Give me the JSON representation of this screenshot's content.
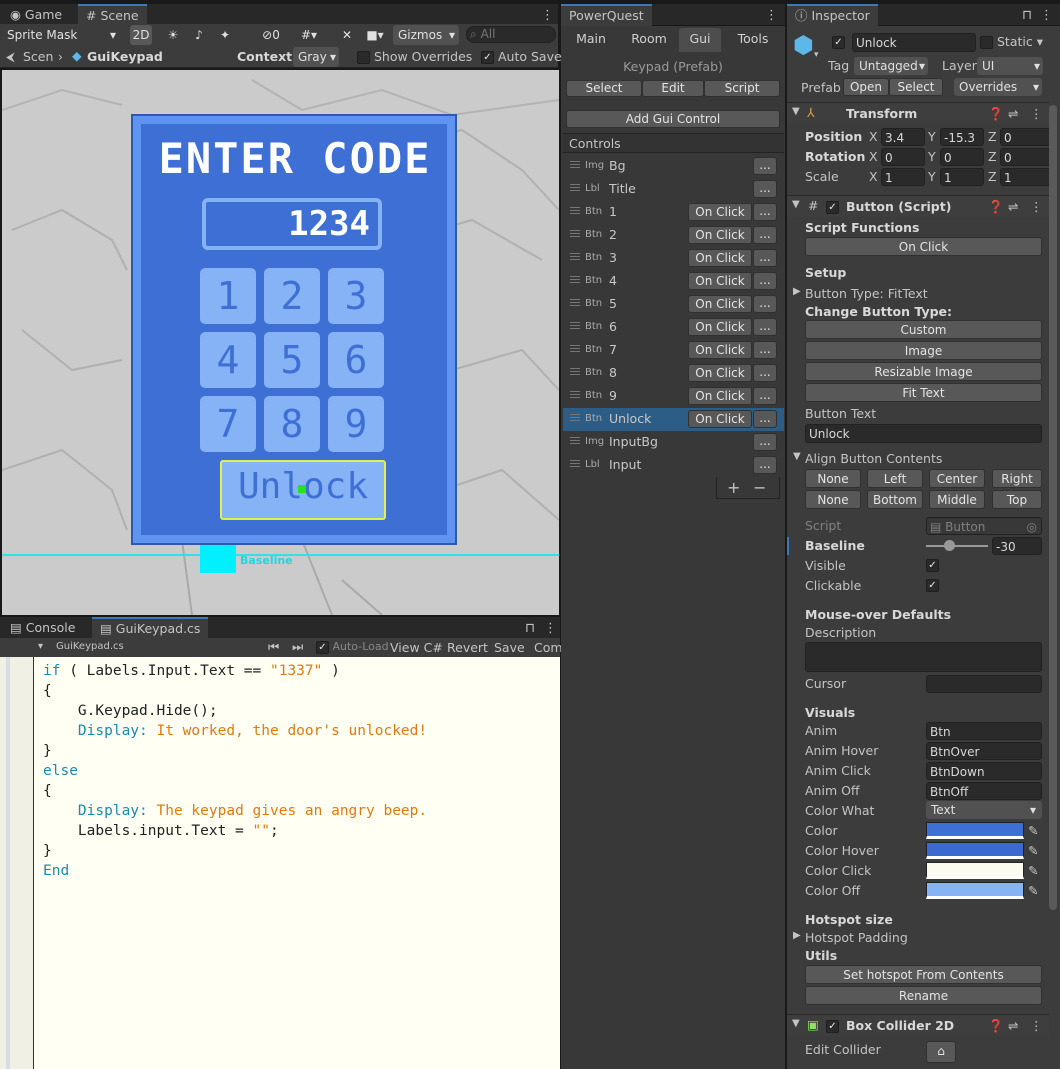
{
  "scene": {
    "tab_game": "Game",
    "tab_scene": "Scene",
    "sprite_mask": "Sprite Mask",
    "btn_2d": "2D",
    "hidden_count": "0",
    "gizmos": "Gizmos",
    "search_placeholder": "All",
    "breadcrumb_root": "Scen",
    "breadcrumb_prefab": "GuiKeypad",
    "context_label": "Context:",
    "context_value": "Gray",
    "show_overrides": "Show Overrides",
    "auto_save": "Auto Save",
    "baseline_label": "Baseline",
    "keypad": {
      "title": "ENTER CODE",
      "input": "1234",
      "keys": [
        "1",
        "2",
        "3",
        "4",
        "5",
        "6",
        "7",
        "8",
        "9"
      ],
      "unlock": "Unlock"
    }
  },
  "editor": {
    "tab_console": "Console",
    "tab_file": "GuiKeypad.cs",
    "file_label": "GuiKeypad.cs",
    "auto_load": "Auto-Load",
    "view_cs": "View C#",
    "revert": "Revert",
    "save": "Save",
    "com": "Com",
    "lines": [
      {
        "parts": [
          [
            "k",
            "if"
          ],
          [
            "p",
            " ( Labels.Input.Text == "
          ],
          [
            "s",
            "\"1337\""
          ],
          [
            "p",
            " )"
          ]
        ]
      },
      {
        "parts": [
          [
            "p",
            "{"
          ]
        ]
      },
      {
        "parts": [
          [
            "p",
            "    G.Keypad.Hide();"
          ]
        ]
      },
      {
        "parts": [
          [
            "k",
            "    Display:"
          ],
          [
            "s",
            " It worked, the door's unlocked!"
          ]
        ]
      },
      {
        "parts": [
          [
            "p",
            "}"
          ]
        ]
      },
      {
        "parts": [
          [
            "k",
            "else"
          ]
        ]
      },
      {
        "parts": [
          [
            "p",
            "{"
          ]
        ]
      },
      {
        "parts": [
          [
            "k",
            "    Display:"
          ],
          [
            "s",
            " The keypad gives an angry beep."
          ]
        ]
      },
      {
        "parts": [
          [
            "p",
            "    Labels.input.Text = "
          ],
          [
            "s",
            "\"\""
          ],
          [
            "p",
            ";"
          ]
        ]
      },
      {
        "parts": [
          [
            "p",
            "}"
          ]
        ]
      },
      {
        "parts": [
          [
            "k",
            "End"
          ]
        ]
      }
    ]
  },
  "powerquest": {
    "title": "PowerQuest",
    "tabs": [
      "Main",
      "Room",
      "Gui",
      "Tools"
    ],
    "prefab": "Keypad (Prefab)",
    "select": "Select",
    "edit": "Edit",
    "script": "Script",
    "add_control": "Add Gui Control",
    "controls_label": "Controls",
    "on_click": "On Click",
    "more": "...",
    "plus": "+",
    "minus": "−",
    "controls": [
      {
        "type": "Img",
        "name": "Bg",
        "onclick": false
      },
      {
        "type": "Lbl",
        "name": "Title",
        "onclick": false
      },
      {
        "type": "Btn",
        "name": "1",
        "onclick": true
      },
      {
        "type": "Btn",
        "name": "2",
        "onclick": true
      },
      {
        "type": "Btn",
        "name": "3",
        "onclick": true
      },
      {
        "type": "Btn",
        "name": "4",
        "onclick": true
      },
      {
        "type": "Btn",
        "name": "5",
        "onclick": true
      },
      {
        "type": "Btn",
        "name": "6",
        "onclick": true
      },
      {
        "type": "Btn",
        "name": "7",
        "onclick": true
      },
      {
        "type": "Btn",
        "name": "8",
        "onclick": true
      },
      {
        "type": "Btn",
        "name": "9",
        "onclick": true
      },
      {
        "type": "Btn",
        "name": "Unlock",
        "onclick": true,
        "selected": true
      },
      {
        "type": "Img",
        "name": "InputBg",
        "onclick": false
      },
      {
        "type": "Lbl",
        "name": "Input",
        "onclick": false
      }
    ]
  },
  "inspector": {
    "title": "Inspector",
    "object_name": "Unlock",
    "static": "Static",
    "tag_label": "Tag",
    "tag_value": "Untagged",
    "layer_label": "Layer",
    "layer_value": "UI",
    "prefab_label": "Prefab",
    "open": "Open",
    "select": "Select",
    "overrides": "Overrides",
    "transform": {
      "title": "Transform",
      "position": "Position",
      "rotation": "Rotation",
      "scale": "Scale",
      "pos": [
        "3.4",
        "-15.3",
        "0"
      ],
      "rot": [
        "0",
        "0",
        "0"
      ],
      "scl": [
        "1",
        "1",
        "1"
      ],
      "x": "X",
      "y": "Y",
      "z": "Z"
    },
    "button": {
      "title": "Button (Script)",
      "script_functions": "Script Functions",
      "on_click": "On Click",
      "setup": "Setup",
      "button_type": "Button Type: FitText",
      "change_type": "Change Button Type:",
      "custom": "Custom",
      "image": "Image",
      "resizable": "Resizable Image",
      "fit_text": "Fit Text",
      "button_text_label": "Button Text",
      "button_text": "Unlock",
      "align": "Align Button Contents",
      "align_h": [
        "None",
        "Left",
        "Center",
        "Right"
      ],
      "align_v": [
        "None",
        "Bottom",
        "Middle",
        "Top"
      ],
      "script_label": "Script",
      "script_value": "Button",
      "baseline": "Baseline",
      "baseline_value": "-30",
      "visible": "Visible",
      "clickable": "Clickable",
      "mouseover": "Mouse-over Defaults",
      "description": "Description",
      "cursor": "Cursor",
      "visuals": "Visuals",
      "anims": [
        {
          "label": "Anim",
          "value": "Btn"
        },
        {
          "label": "Anim Hover",
          "value": "BtnOver"
        },
        {
          "label": "Anim Click",
          "value": "BtnDown"
        },
        {
          "label": "Anim Off",
          "value": "BtnOff"
        }
      ],
      "color_what_label": "Color What",
      "color_what": "Text",
      "colors": [
        {
          "label": "Color",
          "hex": "#3d6fd4"
        },
        {
          "label": "Color Hover",
          "hex": "#3a6ad0"
        },
        {
          "label": "Color Click",
          "hex": "#fbfbef"
        },
        {
          "label": "Color Off",
          "hex": "#86b3f6"
        }
      ],
      "hotspot_size": "Hotspot size",
      "hotspot_padding": "Hotspot Padding",
      "utils": "Utils",
      "set_hotspot": "Set hotspot From Contents",
      "rename": "Rename"
    },
    "collider": {
      "title": "Box Collider 2D",
      "edit_collider": "Edit Collider"
    }
  }
}
